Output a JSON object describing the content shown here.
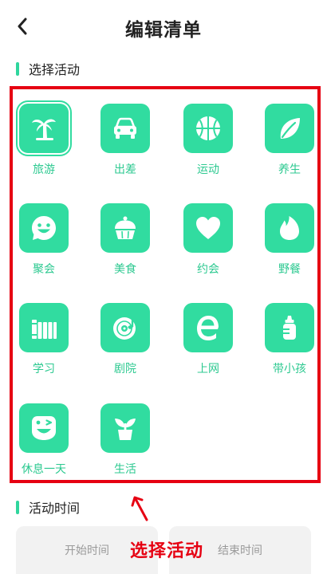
{
  "header": {
    "title": "编辑清单",
    "back_icon": "chevron-left-icon"
  },
  "colors": {
    "accent": "#31dca0",
    "accent_text": "#2cc990",
    "annotation_red": "#e60012"
  },
  "section_activity": {
    "label": "选择活动"
  },
  "activities": [
    {
      "label": "旅游",
      "icon": "palm-tree-icon",
      "selected": true
    },
    {
      "label": "出差",
      "icon": "car-icon"
    },
    {
      "label": "运动",
      "icon": "basketball-icon"
    },
    {
      "label": "养生",
      "icon": "leaf-icon"
    },
    {
      "label": "聚会",
      "icon": "smiley-chat-icon"
    },
    {
      "label": "美食",
      "icon": "cupcake-icon"
    },
    {
      "label": "约会",
      "icon": "heart-icon"
    },
    {
      "label": "野餐",
      "icon": "flame-icon"
    },
    {
      "label": "学习",
      "icon": "books-icon"
    },
    {
      "label": "剧院",
      "icon": "record-music-icon"
    },
    {
      "label": "上网",
      "icon": "browser-e-icon"
    },
    {
      "label": "带小孩",
      "icon": "baby-bottle-icon"
    },
    {
      "label": "休息一天",
      "icon": "wink-face-icon"
    },
    {
      "label": "生活",
      "icon": "plant-pot-icon"
    }
  ],
  "section_time": {
    "label": "活动时间"
  },
  "time": {
    "start_label": "开始时间",
    "end_label": "结束时间"
  },
  "annotation": {
    "text": "选择活动"
  }
}
